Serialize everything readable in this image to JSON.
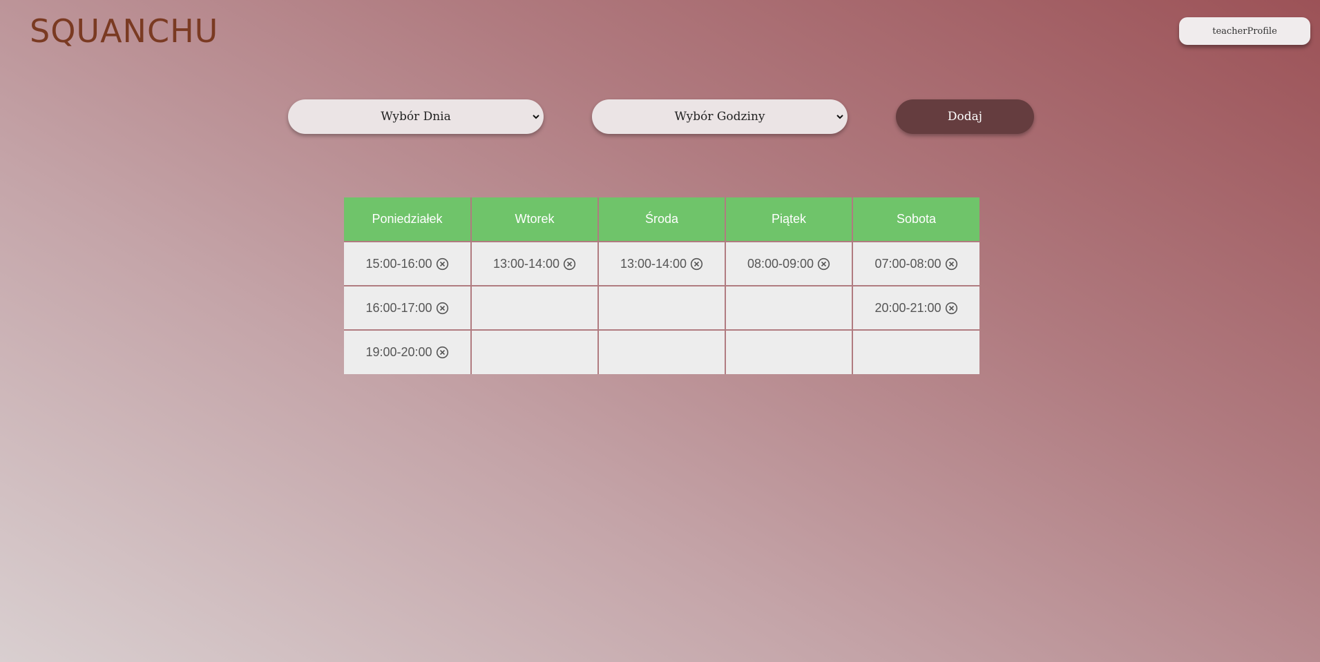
{
  "header": {
    "logo": "SQUANCHU",
    "profile_button": "teacherProfile"
  },
  "controls": {
    "day_select": "Wybór Dnia",
    "hour_select": "Wybór Godziny",
    "add_button": "Dodaj"
  },
  "schedule": {
    "days": [
      "Poniedziałek",
      "Wtorek",
      "Środa",
      "Piątek",
      "Sobota"
    ],
    "rows": [
      [
        "15:00-16:00",
        "13:00-14:00",
        "13:00-14:00",
        "08:00-09:00",
        "07:00-08:00"
      ],
      [
        "16:00-17:00",
        "",
        "",
        "",
        "20:00-21:00"
      ],
      [
        "19:00-20:00",
        "",
        "",
        "",
        ""
      ]
    ]
  },
  "icons": {
    "remove": "circle-x-icon",
    "select": "chevron-down-icon"
  },
  "colors": {
    "header_green": "#6fc46a",
    "add_button": "#653d3f",
    "logo": "#7a3a22"
  }
}
